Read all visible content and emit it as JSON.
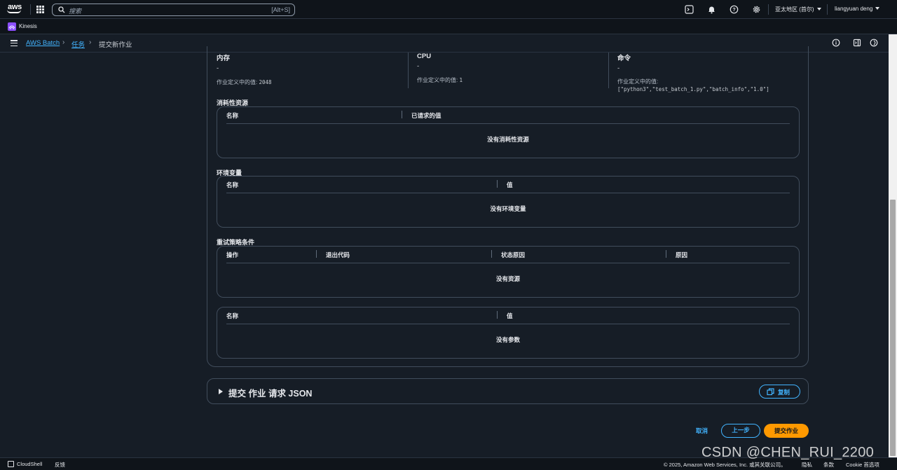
{
  "nav": {
    "logo_text": "aws",
    "search_placeholder": "搜索",
    "search_shortcut": "[Alt+S]",
    "region": "亚太地区 (首尔)",
    "user": "liangyuan deng"
  },
  "service_bar": {
    "service": "Kinesis"
  },
  "breadcrumb": {
    "items": [
      "AWS Batch",
      "任务"
    ],
    "current": "提交新作业"
  },
  "metrics": {
    "memory": {
      "title": "内存",
      "value": "-",
      "note_label": "作业定义中的值:",
      "note_value": "2048"
    },
    "cpu": {
      "title": "CPU",
      "value": "-",
      "note_label": "作业定义中的值:",
      "note_value": "1"
    },
    "command": {
      "title": "命令",
      "value": "-",
      "note_label": "作业定义中的值:",
      "note_value": "[\"python3\",\"test_batch_1.py\",\"batch_info\",\"1.0\"]"
    }
  },
  "consumables": {
    "label": "消耗性资源",
    "columns": [
      "名称",
      "已请求的值"
    ],
    "empty": "没有消耗性资源"
  },
  "env_vars": {
    "label": "环境变量",
    "columns": [
      "名称",
      "值"
    ],
    "empty": "没有环境变量"
  },
  "retry": {
    "label": "重试策略条件",
    "columns": [
      "操作",
      "退出代码",
      "状态原因",
      "原因"
    ],
    "empty": "没有资源"
  },
  "params": {
    "columns": [
      "名称",
      "值"
    ],
    "empty": "没有参数"
  },
  "json_section": {
    "title": "提交 作业 请求 JSON",
    "copy_label": "复制"
  },
  "actions": {
    "cancel": "取消",
    "previous": "上一步",
    "submit": "提交作业"
  },
  "footer": {
    "cloudshell": "CloudShell",
    "feedback": "反馈",
    "copyright": "© 2025, Amazon Web Services, Inc. 或其关联公司。",
    "privacy": "隐私",
    "terms": "条款",
    "cookies": "Cookie 首选项"
  },
  "watermark": "CSDN @CHEN_RUI_2200",
  "colors": {
    "accent": "#42b4ff",
    "primary": "#ff9900",
    "background": "#161d26"
  }
}
